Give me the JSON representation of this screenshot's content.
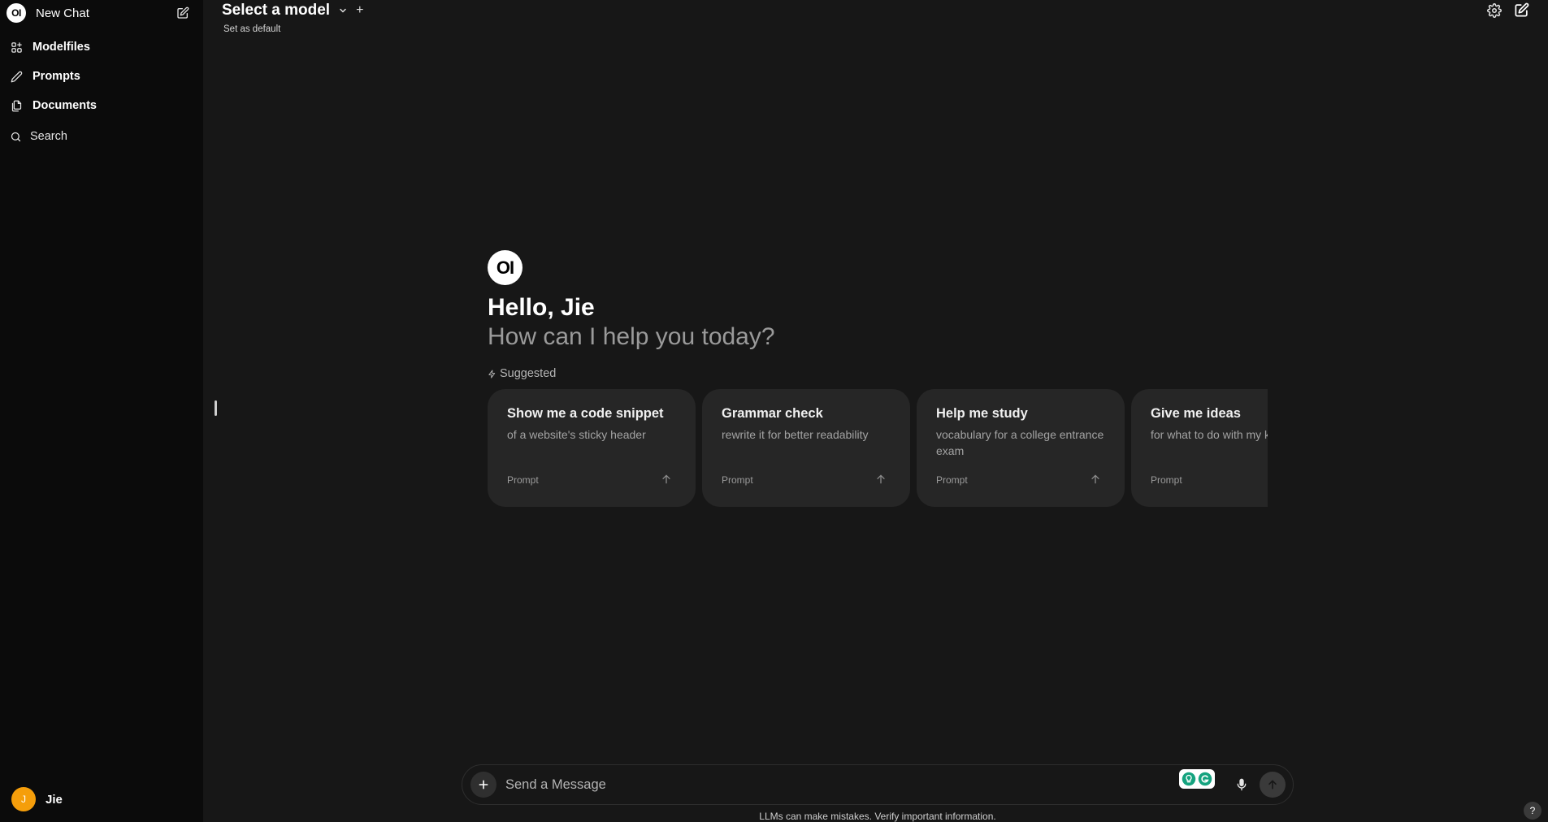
{
  "sidebar": {
    "logo_text": "OI",
    "new_chat_label": "New Chat",
    "nav": [
      {
        "label": "Modelfiles",
        "icon": "modelfiles-icon"
      },
      {
        "label": "Prompts",
        "icon": "pencil-icon"
      },
      {
        "label": "Documents",
        "icon": "documents-icon"
      }
    ],
    "search_label": "Search",
    "user": {
      "initial": "J",
      "name": "Jie",
      "avatar_color": "#f59e0b"
    }
  },
  "header": {
    "title": "Select a model",
    "plus": "+",
    "set_default": "Set as default"
  },
  "main": {
    "logo_text": "OI",
    "greeting": "Hello, Jie",
    "subgreeting": "How can I help you today?",
    "suggested_label": "Suggested",
    "cards": [
      {
        "title": "Show me a code snippet",
        "subtitle": "of a website's sticky header",
        "footer": "Prompt"
      },
      {
        "title": "Grammar check",
        "subtitle": "rewrite it for better readability",
        "footer": "Prompt"
      },
      {
        "title": "Help me study",
        "subtitle": "vocabulary for a college entrance exam",
        "footer": "Prompt"
      },
      {
        "title": "Give me ideas",
        "subtitle": "for what to do with my kids' art",
        "footer": "Prompt"
      }
    ]
  },
  "input": {
    "placeholder": "Send a Message"
  },
  "footer": {
    "disclaimer": "LLMs can make mistakes. Verify important information.",
    "help": "?"
  },
  "colors": {
    "background": "#171717",
    "sidebar": "#0b0b0b",
    "card": "#262626",
    "extension_green": "#15a37f"
  }
}
